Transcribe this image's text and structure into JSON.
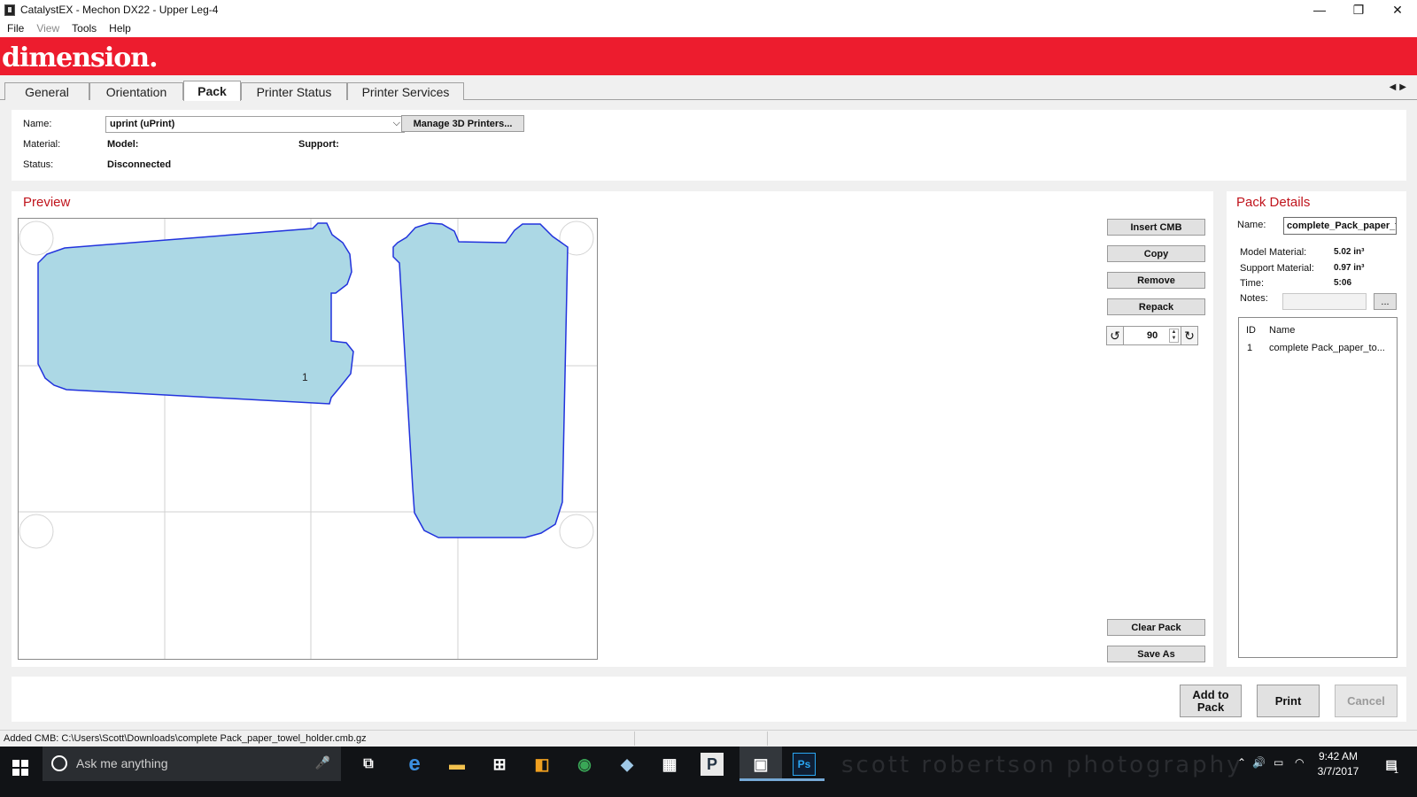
{
  "window": {
    "title": "CatalystEX - Mechon DX22 - Upper Leg-4",
    "minimize": "—",
    "maximize": "❐",
    "close": "✕"
  },
  "menu": [
    "File",
    "View",
    "Tools",
    "Help"
  ],
  "brand": {
    "logo_text": "dimension.",
    "color": "#ed1c2e"
  },
  "tabs": [
    "General",
    "Orientation",
    "Pack",
    "Printer Status",
    "Printer Services"
  ],
  "active_tab": "Pack",
  "printer": {
    "name_label": "Name:",
    "name_value": "uprint  (uPrint)",
    "manage_button": "Manage 3D Printers...",
    "material_label": "Material:",
    "model_label": "Model:",
    "support_label": "Support:",
    "status_label": "Status:",
    "status_value": "Disconnected"
  },
  "preview": {
    "title": "Preview",
    "part_id_label": "1"
  },
  "pack_buttons": {
    "insert": "Insert CMB",
    "copy": "Copy",
    "remove": "Remove",
    "repack": "Repack",
    "rotation_angle": "90",
    "clear": "Clear Pack",
    "save_as": "Save As"
  },
  "pack_details": {
    "title": "Pack Details",
    "name_label": "Name:",
    "name_value": "complete_Pack_paper_t",
    "model_material_label": "Model Material:",
    "model_material_value": "5.02 in³",
    "support_material_label": "Support Material:",
    "support_material_value": "0.97 in³",
    "time_label": "Time:",
    "time_value": "5:06",
    "notes_label": "Notes:",
    "notes_button": "...",
    "columns": [
      "ID",
      "Name"
    ],
    "rows": [
      {
        "id": "1",
        "name": "complete Pack_paper_to..."
      }
    ]
  },
  "actions": {
    "add_to_pack_line1": "Add to",
    "add_to_pack_line2": "Pack",
    "print": "Print",
    "cancel": "Cancel"
  },
  "status_bar": "Added CMB: C:\\Users\\Scott\\Downloads\\complete Pack_paper_towel_holder.cmb.gz",
  "taskbar": {
    "search_placeholder": "Ask me anything",
    "watermark": "scott robertson photography",
    "time": "9:42 AM",
    "date": "3/7/2017",
    "notification_count": "1",
    "accent": "#76a9d6"
  }
}
